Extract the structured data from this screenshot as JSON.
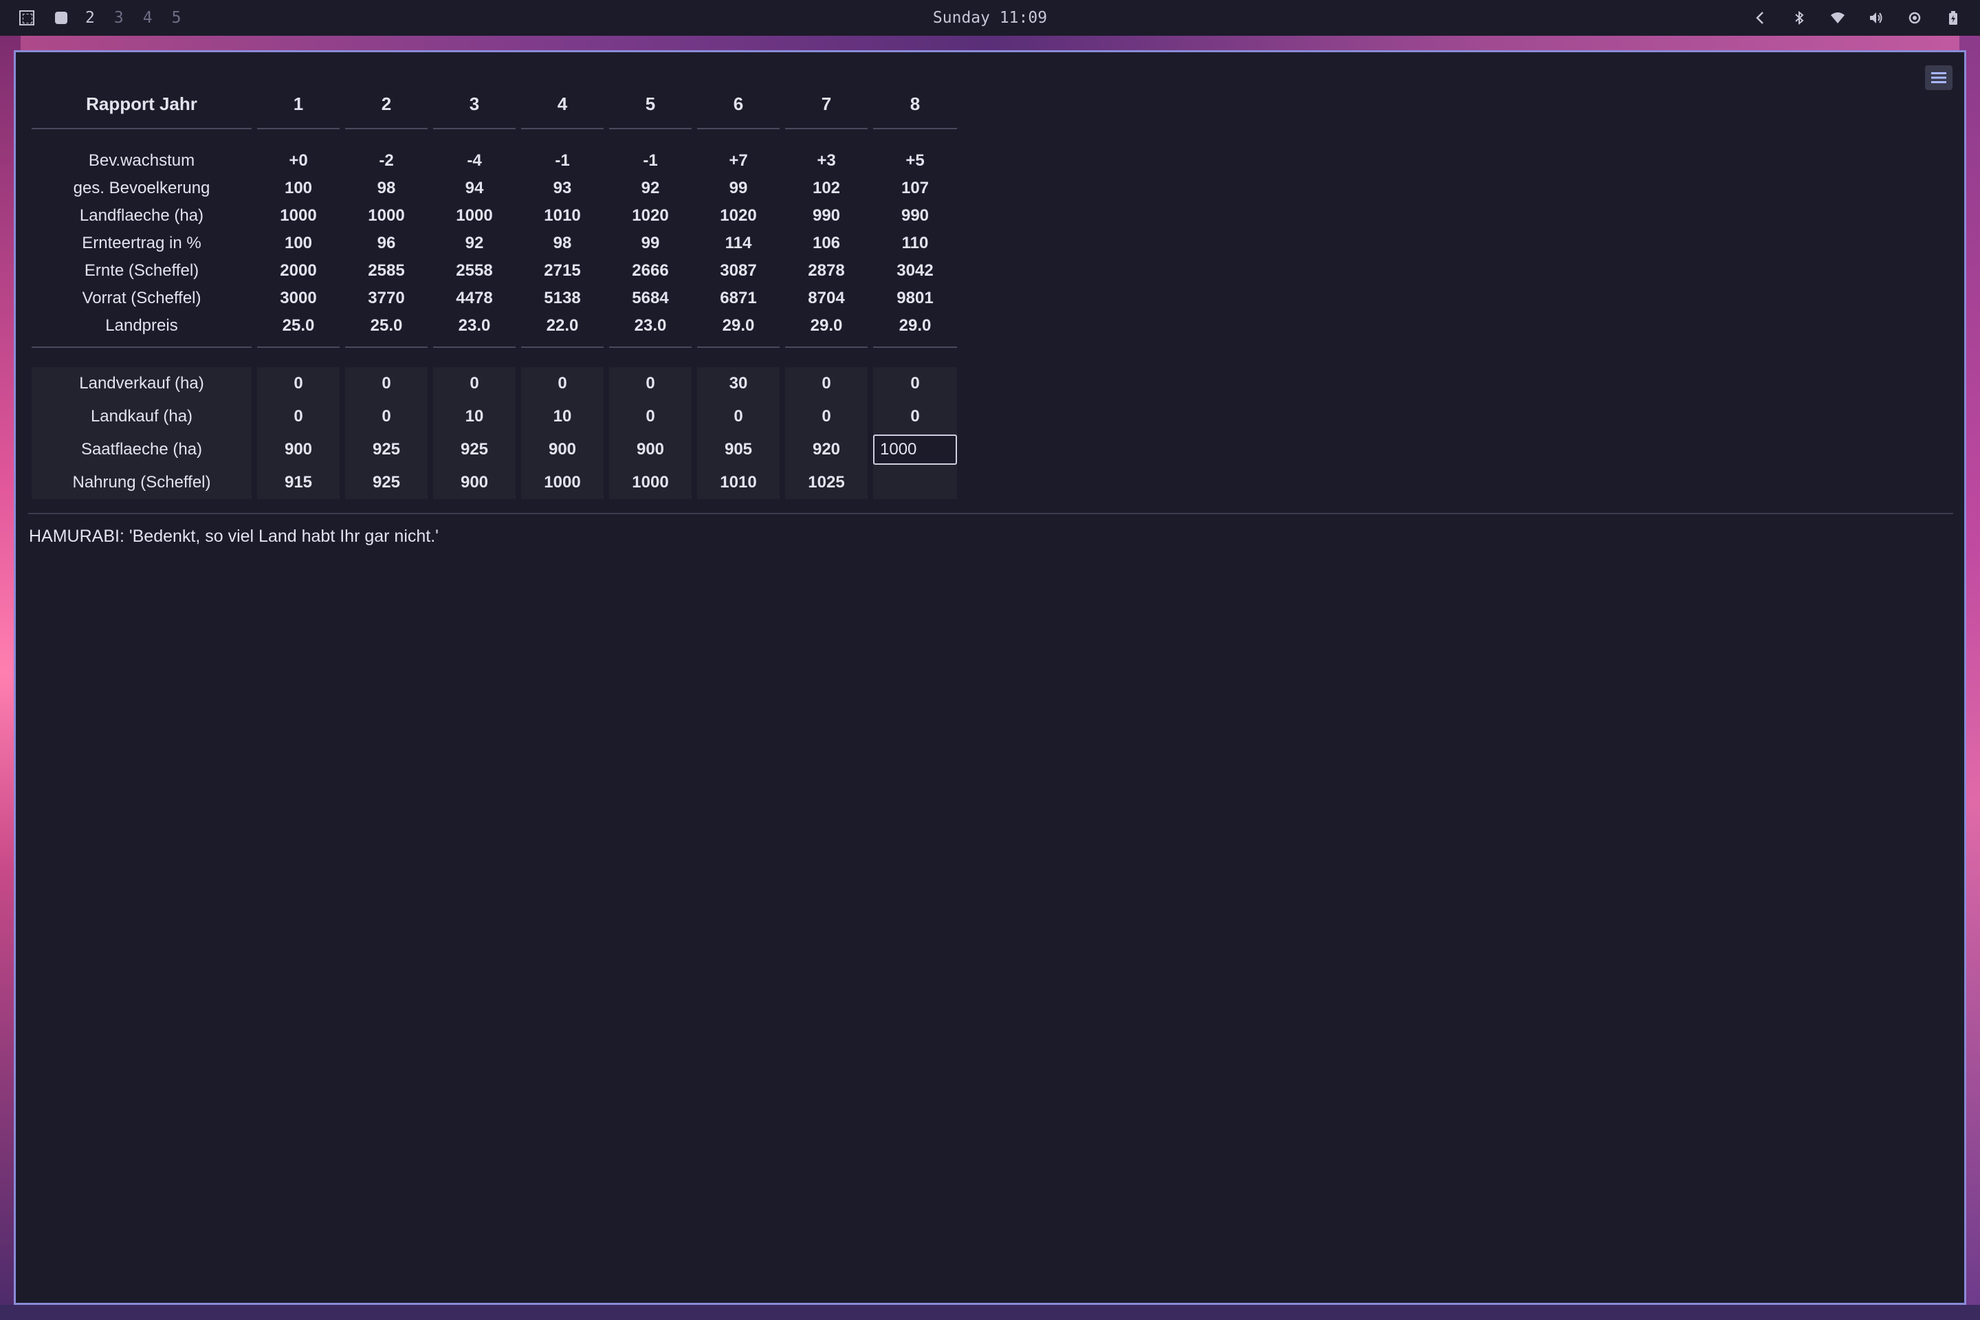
{
  "topbar": {
    "workspaces": [
      "2",
      "3",
      "4",
      "5"
    ],
    "clock": "Sunday 11:09"
  },
  "report": {
    "header_label": "Rapport Jahr",
    "years": [
      "1",
      "2",
      "3",
      "4",
      "5",
      "6",
      "7",
      "8"
    ],
    "stats": [
      {
        "label": "Bev.wachstum",
        "values": [
          "+0",
          "-2",
          "-4",
          "-1",
          "-1",
          "+7",
          "+3",
          "+5"
        ]
      },
      {
        "label": "ges. Bevoelkerung",
        "values": [
          "100",
          "98",
          "94",
          "93",
          "92",
          "99",
          "102",
          "107"
        ]
      },
      {
        "label": "Landflaeche (ha)",
        "values": [
          "1000",
          "1000",
          "1000",
          "1010",
          "1020",
          "1020",
          "990",
          "990"
        ]
      },
      {
        "label": "Ernteertrag in %",
        "values": [
          "100",
          "96",
          "92",
          "98",
          "99",
          "114",
          "106",
          "110"
        ]
      },
      {
        "label": "Ernte (Scheffel)",
        "values": [
          "2000",
          "2585",
          "2558",
          "2715",
          "2666",
          "3087",
          "2878",
          "3042"
        ]
      },
      {
        "label": "Vorrat (Scheffel)",
        "values": [
          "3000",
          "3770",
          "4478",
          "5138",
          "5684",
          "6871",
          "8704",
          "9801"
        ]
      },
      {
        "label": "Landpreis",
        "values": [
          "25.0",
          "25.0",
          "23.0",
          "22.0",
          "23.0",
          "29.0",
          "29.0",
          "29.0"
        ]
      }
    ],
    "decisions": [
      {
        "label": "Landverkauf (ha)",
        "values": [
          "0",
          "0",
          "0",
          "0",
          "0",
          "30",
          "0",
          "0"
        ]
      },
      {
        "label": "Landkauf (ha)",
        "values": [
          "0",
          "0",
          "10",
          "10",
          "0",
          "0",
          "0",
          "0"
        ]
      },
      {
        "label": "Saatflaeche (ha)",
        "values": [
          "900",
          "925",
          "925",
          "900",
          "900",
          "905",
          "920"
        ],
        "input_value": "1000"
      },
      {
        "label": "Nahrung (Scheffel)",
        "values": [
          "915",
          "925",
          "900",
          "1000",
          "1000",
          "1010",
          "1025",
          ""
        ]
      }
    ]
  },
  "message": "HAMURABI: 'Bedenkt, so viel Land habt Ihr gar nicht.'",
  "colors": {
    "window_bg": "#1c1b2a",
    "window_border": "#8a8cd8",
    "text": "#e3e3ee",
    "topbar_bg": "#1c1b29"
  }
}
